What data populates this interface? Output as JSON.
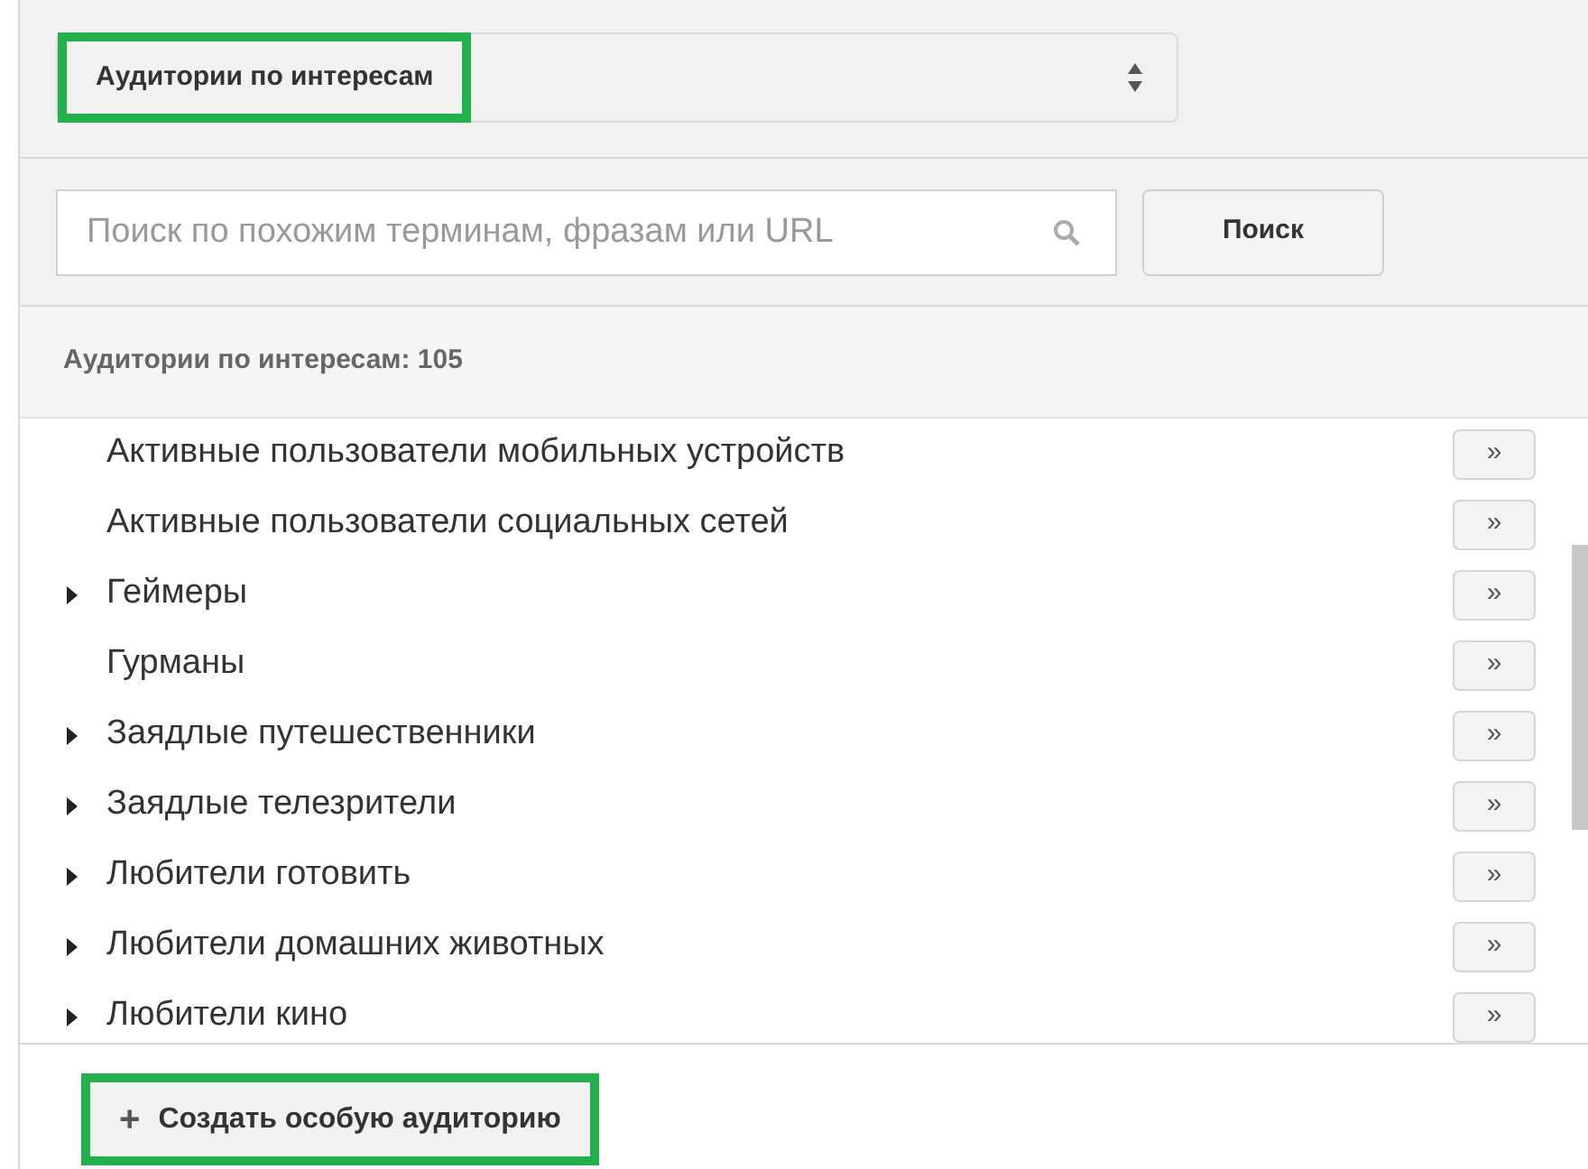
{
  "category_select": {
    "value": "Аудитории по интересам",
    "highlighted": true
  },
  "search": {
    "placeholder": "Поиск по похожим терминам, фразам или URL",
    "button": "Поиск"
  },
  "list_header": "Аудитории по интересам: 105",
  "items": [
    {
      "label": "Активные пользователи мобильных устройств",
      "expandable": false,
      "add": "»"
    },
    {
      "label": "Активные пользователи социальных сетей",
      "expandable": false,
      "add": "»"
    },
    {
      "label": "Геймеры",
      "expandable": true,
      "add": "»"
    },
    {
      "label": "Гурманы",
      "expandable": false,
      "add": "»"
    },
    {
      "label": "Заядлые путешественники",
      "expandable": true,
      "add": "»"
    },
    {
      "label": "Заядлые телезрители",
      "expandable": true,
      "add": "»"
    },
    {
      "label": "Любители готовить",
      "expandable": true,
      "add": "»"
    },
    {
      "label": "Любители домашних животных",
      "expandable": true,
      "add": "»"
    },
    {
      "label": "Любители кино",
      "expandable": true,
      "add": "»"
    }
  ],
  "create_button": {
    "label": "Создать особую аудиторию",
    "icon": "+",
    "highlighted": true
  }
}
